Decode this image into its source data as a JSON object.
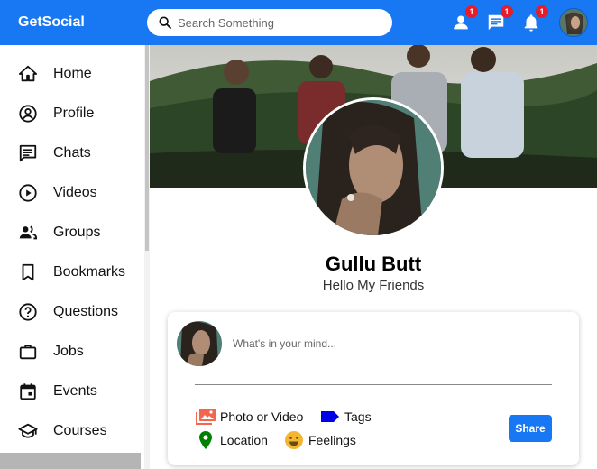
{
  "app": {
    "brand": "GetSocial"
  },
  "search": {
    "placeholder": "Search Something"
  },
  "topbar": {
    "friends_badge": "1",
    "messages_badge": "1",
    "notifications_badge": "1"
  },
  "sidebar": {
    "items": [
      {
        "label": "Home",
        "icon": "home-icon"
      },
      {
        "label": "Profile",
        "icon": "profile-icon"
      },
      {
        "label": "Chats",
        "icon": "chat-icon"
      },
      {
        "label": "Videos",
        "icon": "video-icon"
      },
      {
        "label": "Groups",
        "icon": "groups-icon"
      },
      {
        "label": "Bookmarks",
        "icon": "bookmark-icon"
      },
      {
        "label": "Questions",
        "icon": "question-icon"
      },
      {
        "label": "Jobs",
        "icon": "briefcase-icon"
      },
      {
        "label": "Events",
        "icon": "calendar-icon"
      },
      {
        "label": "Courses",
        "icon": "graduation-cap-icon"
      }
    ]
  },
  "profile": {
    "name": "Gullu Butt",
    "status": "Hello My Friends"
  },
  "post": {
    "placeholder": "What's in your mind...",
    "photo_video_label": "Photo or Video",
    "tags_label": "Tags",
    "location_label": "Location",
    "feelings_label": "Feelings",
    "share_label": "Share"
  },
  "colors": {
    "brand_blue": "#1877f2",
    "badge_red": "#e41e2b",
    "photo_icon": "#f3654d",
    "tags_icon": "#0000e6",
    "location_icon": "#008000",
    "feelings_icon": "#f2b632"
  }
}
